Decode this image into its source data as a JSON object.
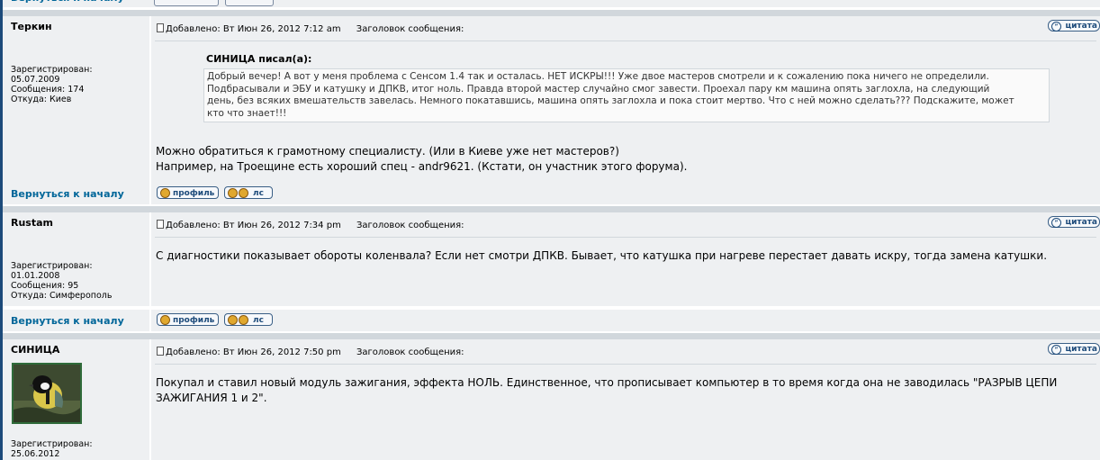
{
  "nav": {
    "back_to_top": "Вернуться к началу"
  },
  "buttons": {
    "profile": "профиль",
    "pm": "лс",
    "quote": "цитата"
  },
  "labels": {
    "posted_prefix": "Добавлено:",
    "subject_label": "Заголовок сообщения:"
  },
  "posts": [
    {
      "author": "Теркин",
      "registered_label": "Зарегистрирован:",
      "registered": "05.07.2009",
      "messages": "Сообщения: 174",
      "location": "Откуда: Киев",
      "date": "Вт Июн 26, 2012 7:12 am",
      "quote": {
        "title": "СИНИЦА писал(а):",
        "lines": [
          "Добрый вечер! А вот у меня проблема с Сенсом 1.4 так и осталась. НЕТ ИСКРЫ!!! Уже двое мастеров смотрели и к сожалению пока ничего не определили.",
          "Подбрасывали и ЭБУ и катушку и ДПКВ, итог ноль. Правда второй мастер случайно смог завести. Проехал пару км машина опять заглохла, на следующий",
          "день, без всяких вмешательств завелась. Немного покатавшись, машина опять заглохла и пока стоит мертво. Что с ней можно сделать??? Подскажите, может",
          "кто что знает!!!"
        ]
      },
      "body": [
        "Можно обратиться к грамотному специалисту. (Или в Киеве уже нет мастеров?)",
        "Например, на Троещине есть хороший спец - andr9621. (Кстати, он участник этого форума)."
      ]
    },
    {
      "author": "Rustam",
      "registered_label": "Зарегистрирован:",
      "registered": "01.01.2008",
      "messages": "Сообщения: 95",
      "location": "Откуда: Симферополь",
      "date": "Вт Июн 26, 2012 7:34 pm",
      "body": [
        "С диагностики показывает обороты коленвала? Если нет смотри ДПКВ. Бывает, что катушка при нагреве перестает давать искру, тогда замена катушки."
      ]
    },
    {
      "author": "СИНИЦА",
      "registered_label": "Зарегистрирован:",
      "registered": "25.06.2012",
      "avatar": "titmouse-bird-avatar",
      "date": "Вт Июн 26, 2012 7:50 pm",
      "body": [
        "Покупал и ставил новый модуль зажигания, эффекта НОЛЬ. Единственное, что прописывает компьютер в то время когда она не заводилась \"РАЗРЫВ ЦЕПИ",
        "ЗАЖИГАНИЯ 1 и 2\"."
      ]
    }
  ],
  "colors": {
    "row_bg": "#eef0f2",
    "spacer": "#d1d7dc",
    "link": "#006699",
    "frame": "#1c4a7a"
  }
}
